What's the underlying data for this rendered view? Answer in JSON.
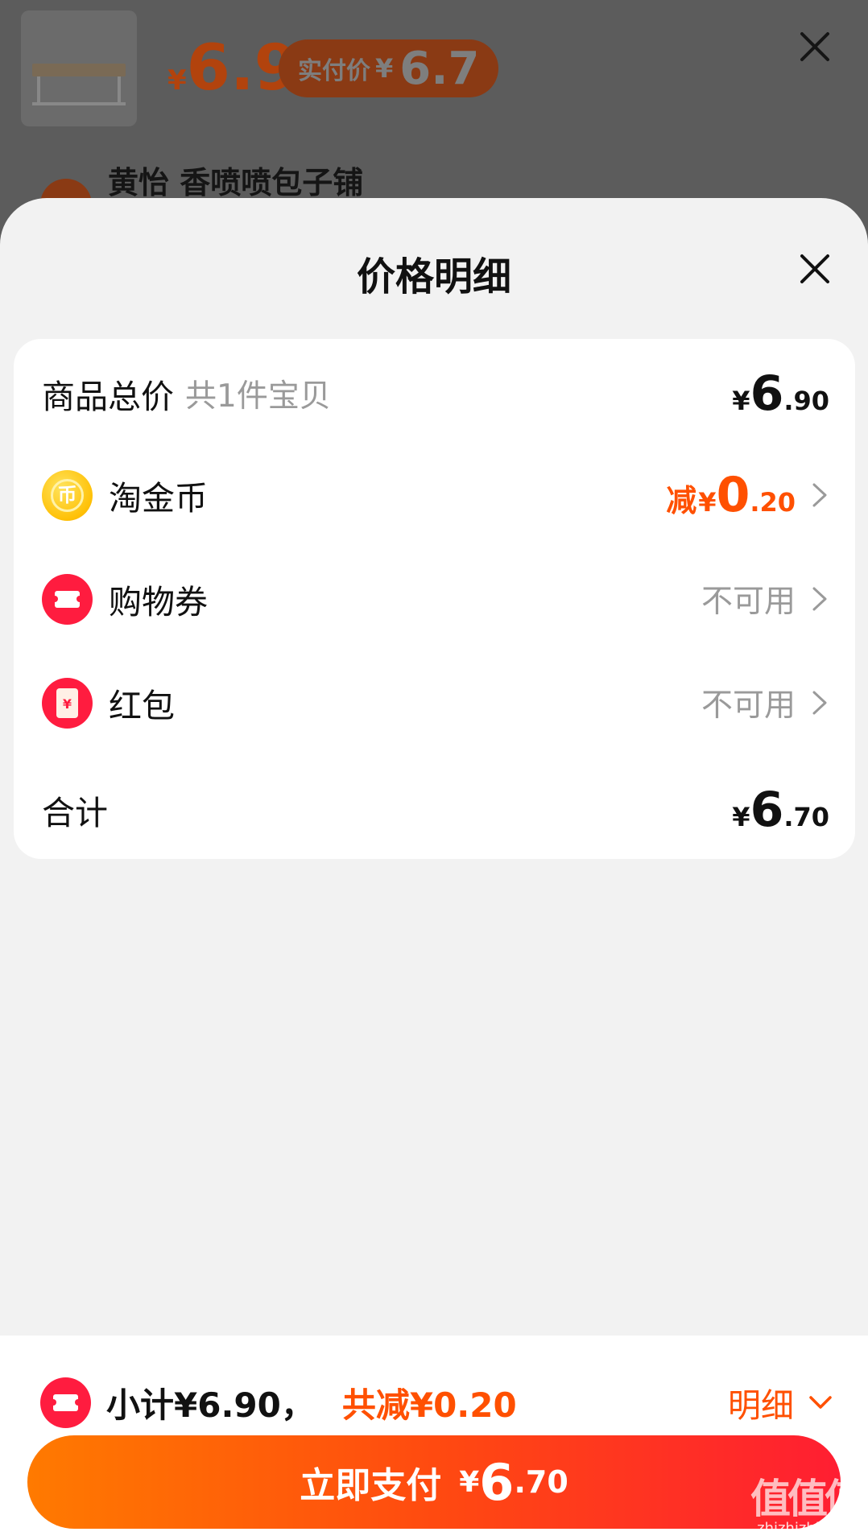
{
  "background": {
    "price_currency": "¥",
    "price_value": "6.9",
    "pay_label": "实付价",
    "pay_currency": "¥",
    "pay_value": "6.7",
    "shop_name": "黄怡 香喷喷包子铺"
  },
  "sheet": {
    "title": "价格明细"
  },
  "rows": {
    "goods_total": {
      "label": "商品总价",
      "sub": "共1件宝贝",
      "currency": "¥",
      "int": "6",
      "dec": ".90"
    },
    "coins": {
      "label": "淘金币",
      "reduce": "减",
      "currency": "¥",
      "int": "0",
      "dec": ".20",
      "icon_text": "币"
    },
    "coupon": {
      "label": "购物券",
      "status": "不可用"
    },
    "hongbao": {
      "label": "红包",
      "status": "不可用",
      "icon_text": "¥"
    },
    "total": {
      "label": "合计",
      "currency": "¥",
      "int": "6",
      "dec": ".70"
    }
  },
  "bottom": {
    "subtotal": "小计¥6.90，",
    "total_reduce": "共减¥0.20",
    "detail_label": "明细",
    "pay_label": "立即支付",
    "pay_currency": "¥",
    "pay_int": "6",
    "pay_dec": ".70"
  },
  "watermark": {
    "big": "值值值",
    "small": "zhizhizhi.com"
  },
  "colors": {
    "accent": "#ff5000",
    "coupon_red": "#ff1c3f",
    "sheet_bg": "#f2f2f2"
  },
  "icons": [
    "close-icon",
    "coin-icon",
    "coupon-icon",
    "red-packet-icon",
    "chevron-right-icon",
    "chevron-down-icon"
  ]
}
